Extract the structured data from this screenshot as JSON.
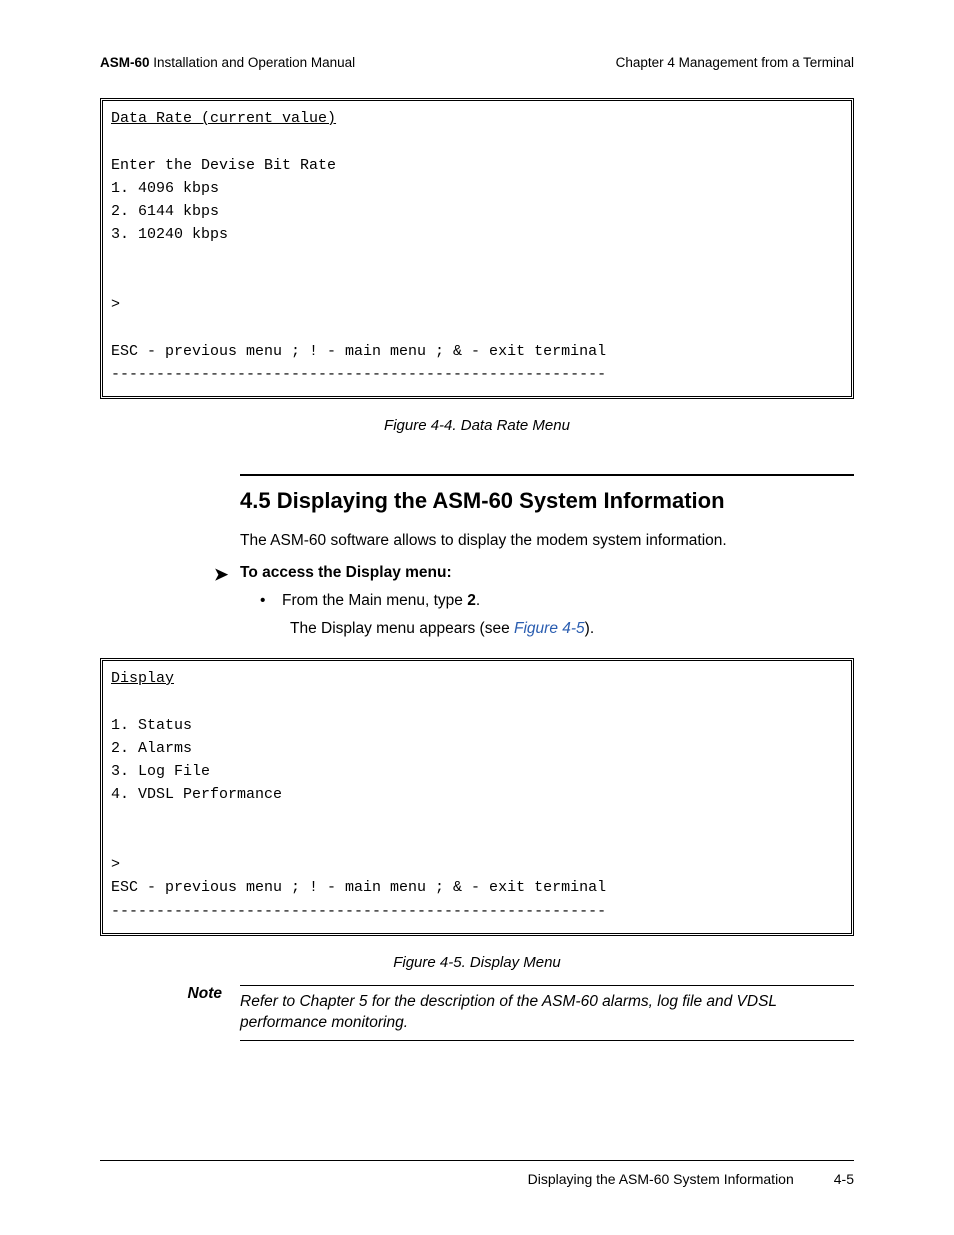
{
  "header": {
    "product": "ASM-60",
    "doc_title_suffix": " Installation and Operation Manual",
    "chapter": "Chapter 4  Management from a Terminal"
  },
  "terminal1": {
    "title": "Data Rate (current value)",
    "lines": [
      "",
      "Enter the Devise Bit Rate",
      "1. 4096 kbps",
      "2. 6144 kbps",
      "3. 10240 kbps",
      "",
      "",
      ">",
      "",
      "ESC - previous menu ; ! - main menu ; & - exit terminal",
      "-------------------------------------------------------"
    ]
  },
  "figure1_caption": "Figure 4-4.  Data Rate Menu",
  "section": {
    "number_title": "4.5  Displaying the ASM-60 System Information",
    "intro": "The ASM-60 software allows to display the modem system information.",
    "proc_head": "To access the Display menu:",
    "bullet_prefix": "From the Main menu, type ",
    "bullet_bold": "2",
    "bullet_suffix": ".",
    "result_prefix": "The Display menu appears (see ",
    "result_xref": "Figure 4-5",
    "result_suffix": ")."
  },
  "terminal2": {
    "title": "Display",
    "lines": [
      "",
      "1. Status",
      "2. Alarms",
      "3. Log File",
      "4. VDSL Performance",
      "",
      "",
      ">",
      "ESC - previous menu ; ! - main menu ; & - exit terminal",
      "-------------------------------------------------------"
    ]
  },
  "figure2_caption": "Figure 4-5.  Display Menu",
  "note": {
    "label": "Note",
    "body": "Refer to Chapter 5 for the description of the ASM-60 alarms, log file and VDSL performance monitoring."
  },
  "footer": {
    "section_name": "Displaying the ASM-60 System Information",
    "page_num": "4-5"
  }
}
